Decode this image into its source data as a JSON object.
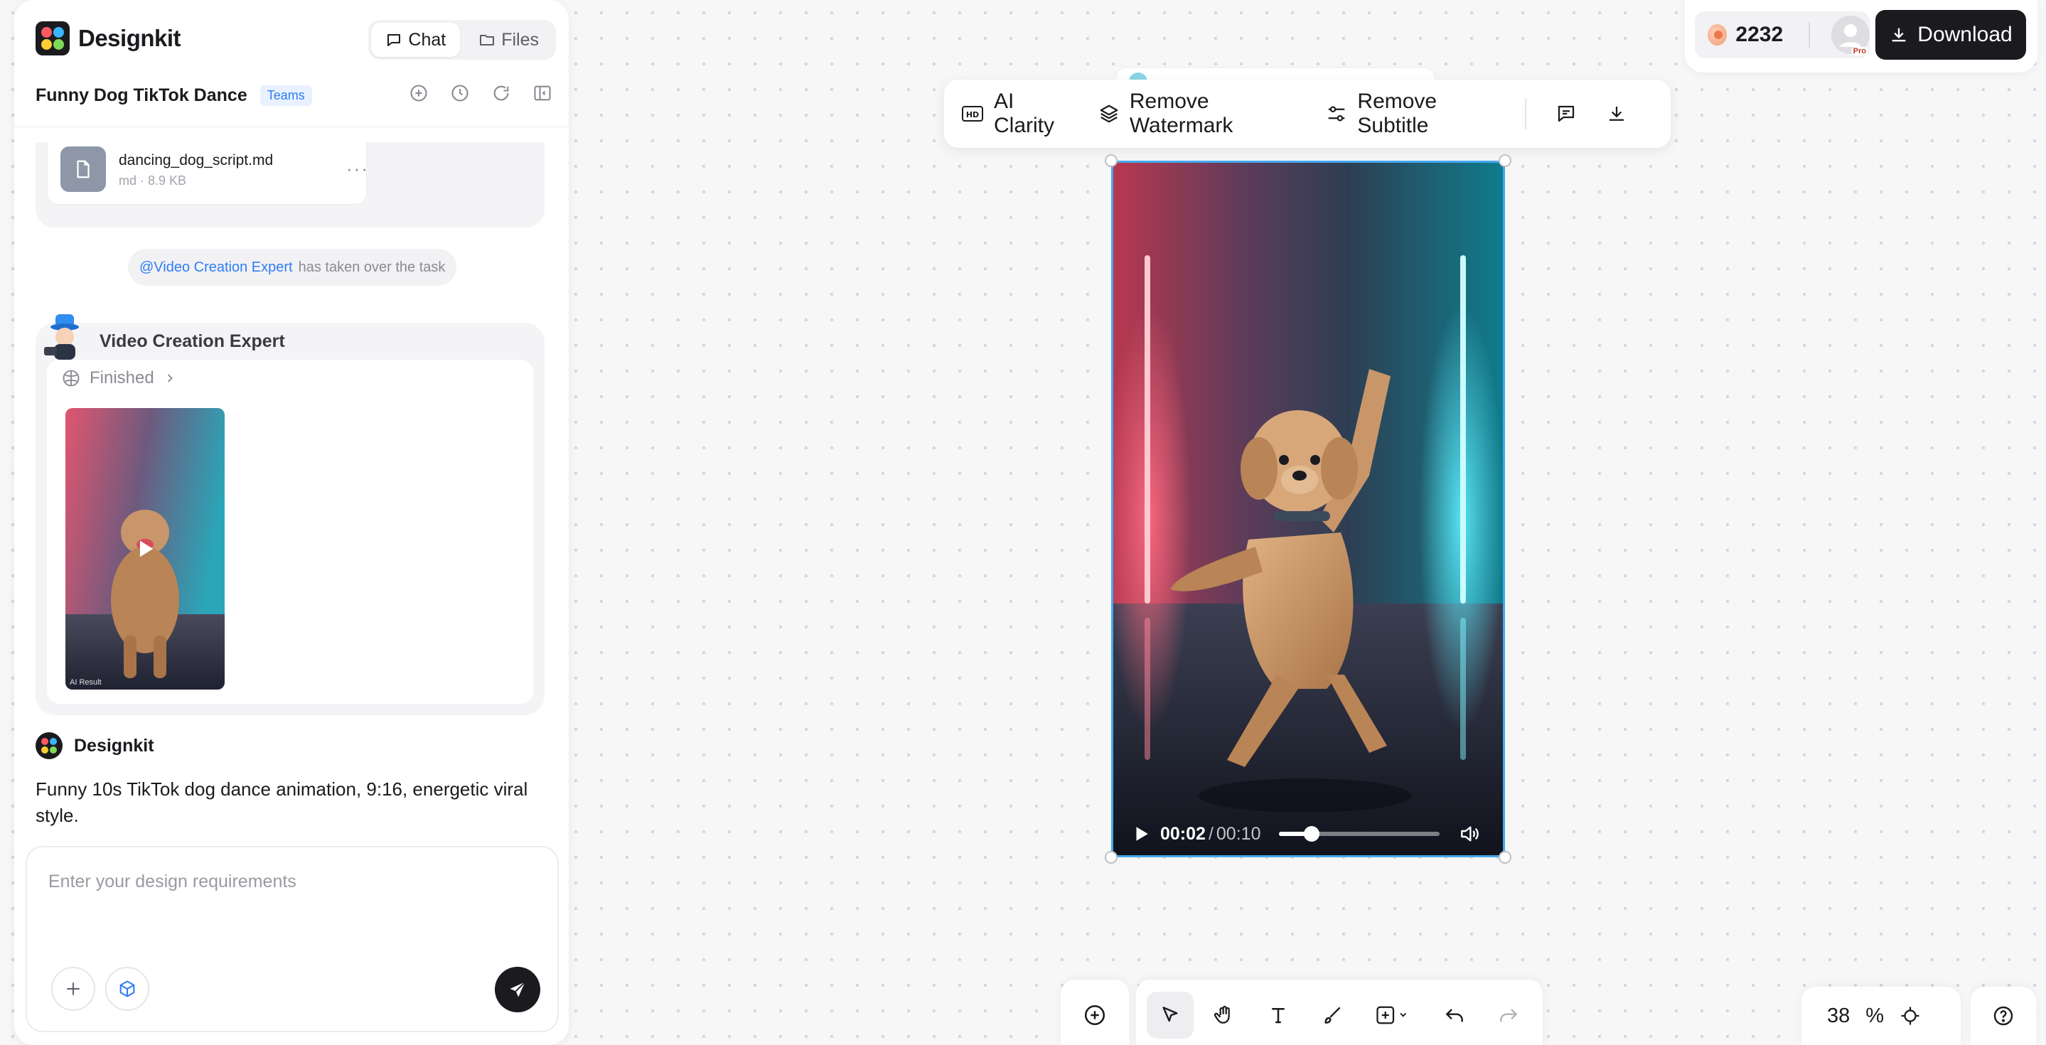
{
  "app": {
    "name": "Designkit",
    "tabs": [
      {
        "label": "Chat",
        "icon": "chat-bubble-icon",
        "active": true
      },
      {
        "label": "Files",
        "icon": "folder-icon",
        "active": false
      }
    ]
  },
  "project": {
    "title": "Funny Dog TikTok Dance",
    "badge": "Teams",
    "actions": [
      "add-circle-icon",
      "history-icon",
      "refresh-icon",
      "collapse-panel-icon"
    ]
  },
  "file": {
    "name": "dancing_dog_script.md",
    "meta": "md · 8.9 KB",
    "more": "···"
  },
  "takeover": {
    "mention": "@Video Creation Expert",
    "text": "has taken over the task"
  },
  "expert": {
    "name": "Video Creation Expert",
    "status": "Finished",
    "thumb_label": "AI Result"
  },
  "ai_message": {
    "sender": "Designkit",
    "text": "Funny 10s TikTok dog dance animation, 9:16, energetic viral style."
  },
  "composer": {
    "placeholder": "Enter your design requirements"
  },
  "header": {
    "credits": "2232",
    "pro_label": "Pro",
    "download_label": "Download"
  },
  "float_toolbar": {
    "ai_clarity": "AI Clarity",
    "remove_watermark": "Remove Watermark",
    "remove_subtitle": "Remove Subtitle"
  },
  "video": {
    "current_time": "00:02",
    "separator": "/",
    "total_time": "00:10",
    "progress": 0.2
  },
  "bottom_toolbar": {
    "tools": [
      "add-location-icon",
      "select-arrow-icon",
      "hand-icon",
      "text-icon",
      "brush-icon",
      "add-shape-icon",
      "undo-icon",
      "redo-icon"
    ]
  },
  "zoom": {
    "value": "38",
    "unit": "%"
  },
  "colors": {
    "accent_blue": "#2f7cf6",
    "selection_border": "#44a8ee",
    "dark": "#1b1b1f"
  }
}
